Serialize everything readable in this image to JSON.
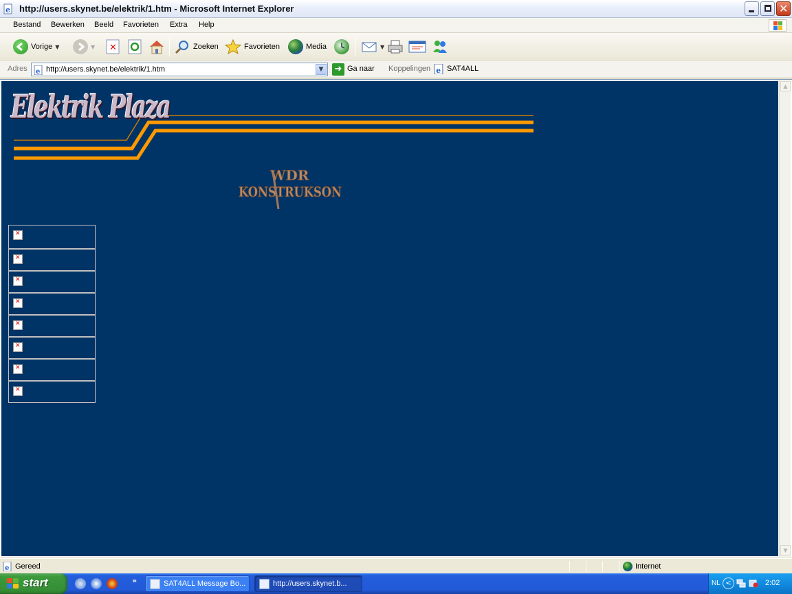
{
  "window": {
    "title": "http://users.skynet.be/elektrik/1.htm - Microsoft Internet Explorer",
    "controls": [
      "minimize-icon",
      "maximize-icon",
      "close-icon"
    ]
  },
  "menu": {
    "items": [
      "Bestand",
      "Bewerken",
      "Beeld",
      "Favorieten",
      "Extra",
      "Help"
    ]
  },
  "toolbar": {
    "back_label": "Vorige",
    "search_label": "Zoeken",
    "favorites_label": "Favorieten",
    "media_label": "Media"
  },
  "address": {
    "label": "Adres",
    "url": "http://users.skynet.be/elektrik/1.htm",
    "go_label": "Ga naar",
    "links_label": "Koppelingen",
    "link_item": "SAT4ALL"
  },
  "page": {
    "background": "#003366",
    "logo_text": "Elektrik Plaza",
    "stripe_color": "#ff9900",
    "construction_text_line1": "WDR",
    "construction_text_line2": "KONSTRUKSON",
    "nav_cell_count": 8
  },
  "status": {
    "text": "Gereed",
    "zone": "Internet"
  },
  "taskbar": {
    "start_label": "start",
    "tasks": [
      {
        "label": "SAT4ALL Message Bo...",
        "active": false
      },
      {
        "label": "http://users.skynet.b...",
        "active": true
      }
    ],
    "language": "NL",
    "clock": "2:02"
  }
}
